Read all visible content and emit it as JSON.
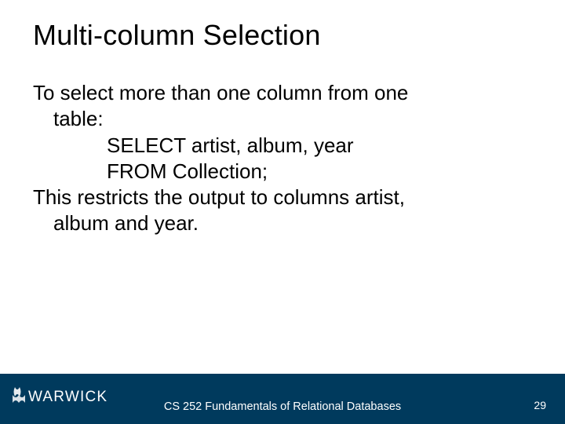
{
  "title": "Multi-column Selection",
  "body": {
    "intro_line1": "To select more than one column from one",
    "intro_line2": "table:",
    "sql_line1": "SELECT artist, album, year",
    "sql_line2": "FROM Collection;",
    "outro_line1": "This restricts the output to columns artist,",
    "outro_line2": "album and year."
  },
  "footer": {
    "logo_text": "WARWICK",
    "course": "CS 252 Fundamentals of Relational Databases",
    "page_number": "29"
  },
  "colors": {
    "footer_bg": "#003a5d"
  }
}
